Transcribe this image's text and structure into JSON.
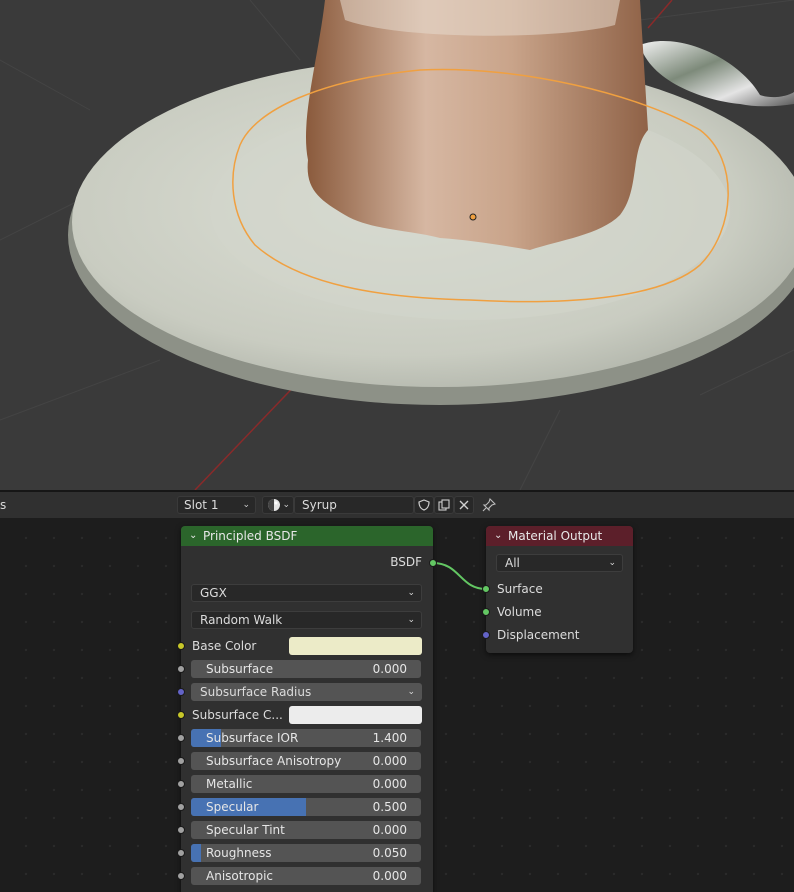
{
  "header": {
    "left_cut_text": "s",
    "slot": "Slot 1",
    "material_name": "Syrup"
  },
  "principled": {
    "title": "Principled BSDF",
    "output_label": "BSDF",
    "distribution": "GGX",
    "subsurface_method": "Random Walk",
    "base_color_label": "Base Color",
    "base_color": "#ecebc8",
    "subsurface_label": "Subsurface",
    "subsurface_value": "0.000",
    "subsurface_radius_label": "Subsurface Radius",
    "subsurface_color_label": "Subsurface C...",
    "subsurface_color": "#ececec",
    "subsurface_ior_label": "Subsurface IOR",
    "subsurface_ior_value": "1.400",
    "subsurface_anisotropy_label": "Subsurface Anisotropy",
    "subsurface_anisotropy_value": "0.000",
    "metallic_label": "Metallic",
    "metallic_value": "0.000",
    "specular_label": "Specular",
    "specular_value": "0.500",
    "specular_tint_label": "Specular Tint",
    "specular_tint_value": "0.000",
    "roughness_label": "Roughness",
    "roughness_value": "0.050",
    "anisotropic_label": "Anisotropic",
    "anisotropic_value": "0.000"
  },
  "output_node": {
    "title": "Material Output",
    "target": "All",
    "surface_label": "Surface",
    "volume_label": "Volume",
    "displacement_label": "Displacement"
  },
  "colors": {
    "shader_header": "#2b652b",
    "output_header": "#5c1f2a",
    "slider_fill": "#4772b3",
    "selection_outline": "#f0a040"
  }
}
